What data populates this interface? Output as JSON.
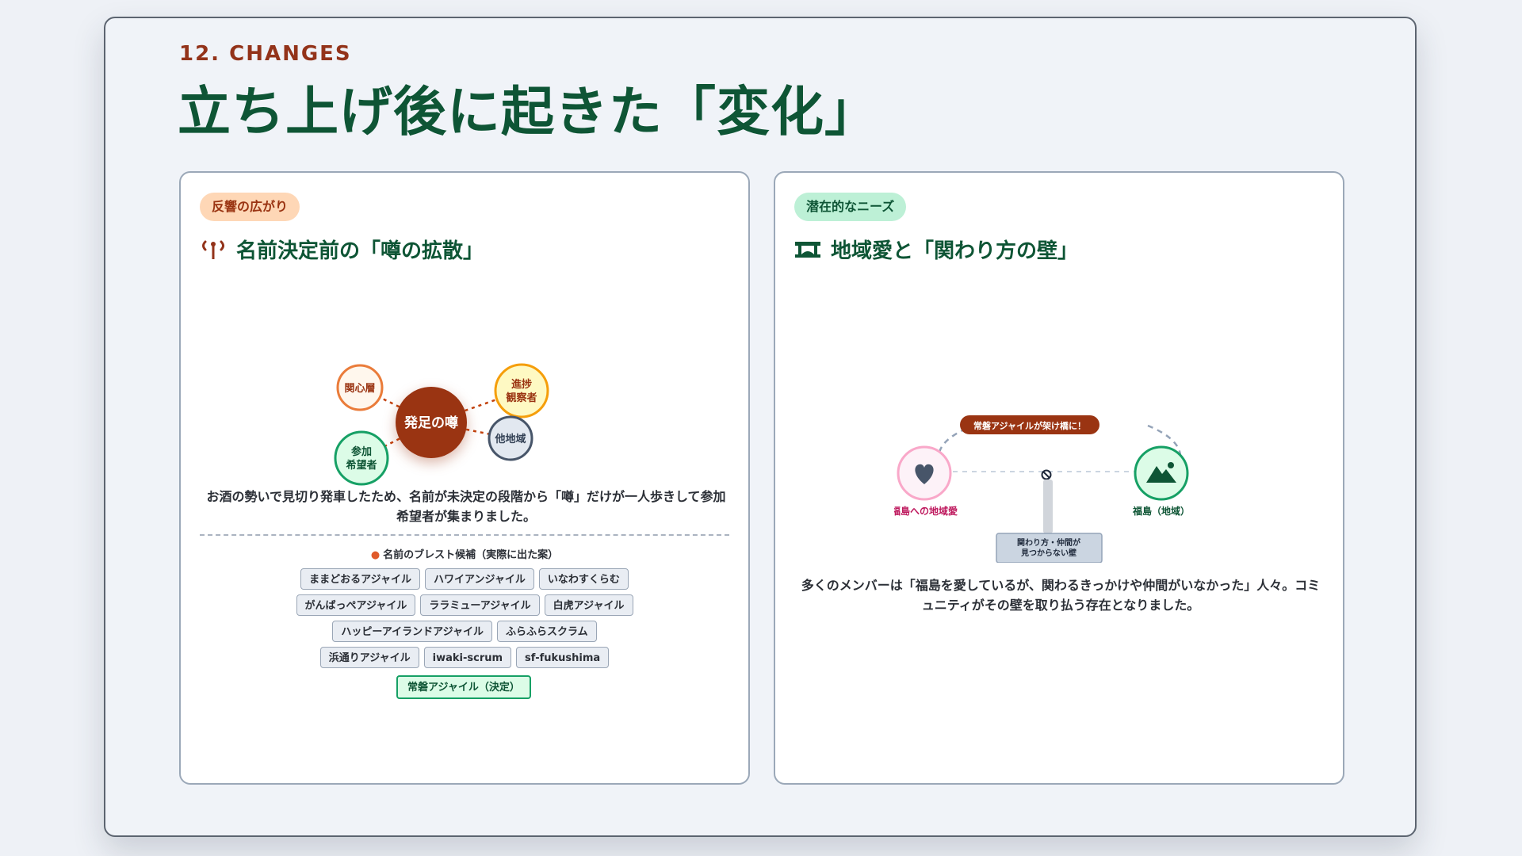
{
  "header": {
    "eyebrow": "12. CHANGES",
    "title": "立ち上げ後に起きた「変化」"
  },
  "left_card": {
    "badge": "反響の広がり",
    "title": "名前決定前の「噂の拡散」",
    "title_icon": "broadcast-icon",
    "diagram": {
      "center": "発足の噂",
      "nodes": {
        "interested": "関心層",
        "observer_line1": "進捗",
        "observer_line2": "観察者",
        "participant_line1": "参加",
        "participant_line2": "希望者",
        "other_region": "他地域"
      }
    },
    "description": "お酒の勢いで見切り発車したため、名前が未決定の段階から「噂」だけが一人歩きして参加希望者が集まりました。",
    "candidates_label": "名前のブレスト候補（実際に出た案）",
    "candidates": [
      "ままどおるアジャイル",
      "ハワイアンジャイル",
      "いなわすくらむ",
      "がんばっぺアジャイル",
      "ララミューアジャイル",
      "白虎アジャイル",
      "ハッピーアイランドアジャイル",
      "ふらふらスクラム",
      "浜通りアジャイル",
      "iwaki-scrum",
      "sf-fukushima"
    ],
    "final_candidate": "常磐アジャイル（決定）"
  },
  "right_card": {
    "badge": "潜在的なニーズ",
    "title": "地域愛と「関わり方の壁」",
    "title_icon": "bridge-icon",
    "diagram": {
      "bridge_label": "常磐アジャイルが架け橋に！",
      "left_label": "福島への地域愛",
      "right_label": "福島（地域）",
      "wall_line1": "関わり方・仲間が",
      "wall_line2": "見つからない壁"
    },
    "description": "多くのメンバーは「福島を愛しているが、関わるきっかけや仲間がいなかった」人々。コミュニティがその壁を取り払う存在となりました。"
  },
  "colors": {
    "primary_green": "#0e5535",
    "accent_red": "#93331a",
    "rumor_center": "#9a3412",
    "love_pink": "#be185d",
    "region_green": "#16a065"
  }
}
